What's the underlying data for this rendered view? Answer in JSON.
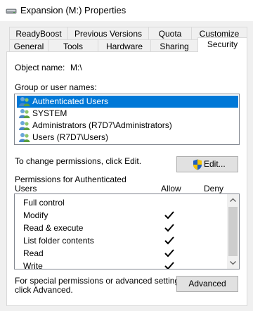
{
  "window": {
    "title": "Expansion (M:) Properties",
    "drive_icon": "drive-icon"
  },
  "tabs_row1": [
    "ReadyBoost",
    "Previous Versions",
    "Quota",
    "Customize"
  ],
  "tabs_row2": [
    "General",
    "Tools",
    "Hardware",
    "Sharing",
    "Security"
  ],
  "active_tab": "Security",
  "object": {
    "label": "Object name:",
    "value": "M:\\"
  },
  "groups": {
    "label": "Group or user names:",
    "items": [
      {
        "label": "Authenticated Users",
        "icon": "users-icon",
        "selected": true
      },
      {
        "label": "SYSTEM",
        "icon": "users-icon",
        "selected": false
      },
      {
        "label": "Administrators (R7D7\\Administrators)",
        "icon": "users-icon",
        "selected": false
      },
      {
        "label": "Users (R7D7\\Users)",
        "icon": "users-icon",
        "selected": false
      }
    ]
  },
  "change_text": "To change permissions, click Edit.",
  "edit_button": "Edit...",
  "permissions": {
    "header_line1": "Permissions for Authenticated",
    "header_line2": "Users",
    "allow": "Allow",
    "deny": "Deny",
    "rows": [
      {
        "name": "Full control",
        "allow": false,
        "deny": false
      },
      {
        "name": "Modify",
        "allow": true,
        "deny": false
      },
      {
        "name": "Read & execute",
        "allow": true,
        "deny": false
      },
      {
        "name": "List folder contents",
        "allow": true,
        "deny": false
      },
      {
        "name": "Read",
        "allow": true,
        "deny": false
      },
      {
        "name": "Write",
        "allow": true,
        "deny": false
      }
    ]
  },
  "advanced": {
    "line1": "For special permissions or advanced settings,",
    "line2": "click Advanced.",
    "button": "Advanced"
  },
  "colors": {
    "selection": "#0078d7",
    "shield_blue": "#1f5fbf",
    "shield_yellow": "#f5c400"
  }
}
